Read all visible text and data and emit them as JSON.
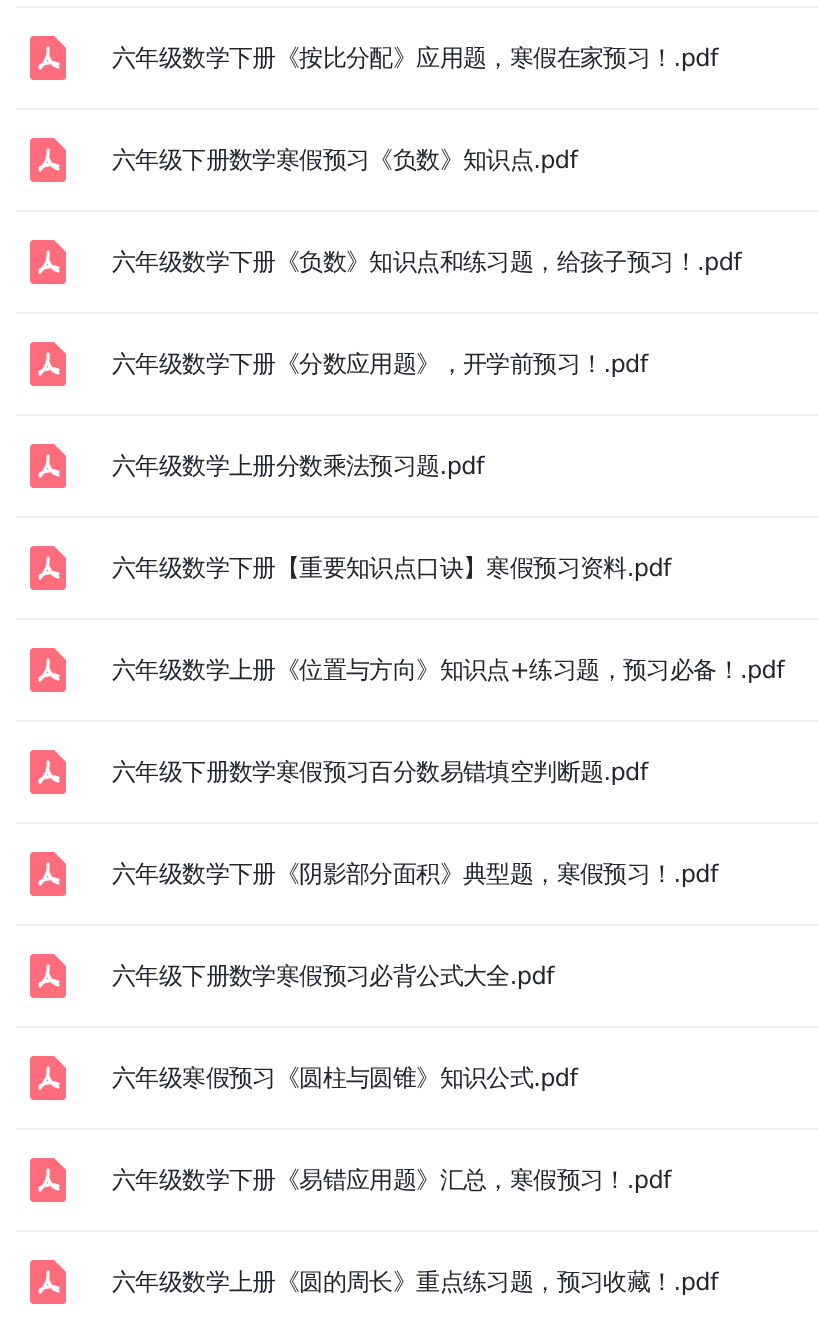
{
  "files": [
    {
      "name": "六年级数学下册《按比分配》应用题，寒假在家预习！.pdf"
    },
    {
      "name": "六年级下册数学寒假预习《负数》知识点.pdf"
    },
    {
      "name": "六年级数学下册《负数》知识点和练习题，给孩子预习！.pdf"
    },
    {
      "name": "六年级数学下册《分数应用题》，开学前预习！.pdf"
    },
    {
      "name": "六年级数学上册分数乘法预习题.pdf"
    },
    {
      "name": "六年级数学下册【重要知识点口诀】寒假预习资料.pdf"
    },
    {
      "name": "六年级数学上册《位置与方向》知识点+练习题，预习必备！.pdf"
    },
    {
      "name": "六年级下册数学寒假预习百分数易错填空判断题.pdf"
    },
    {
      "name": "六年级数学下册《阴影部分面积》典型题，寒假预习！.pdf"
    },
    {
      "name": "六年级下册数学寒假预习必背公式大全.pdf"
    },
    {
      "name": "六年级寒假预习《圆柱与圆锥》知识公式.pdf"
    },
    {
      "name": "六年级数学下册《易错应用题》汇总，寒假预习！.pdf"
    },
    {
      "name": "六年级数学上册《圆的周长》重点练习题，预习收藏！.pdf"
    }
  ]
}
